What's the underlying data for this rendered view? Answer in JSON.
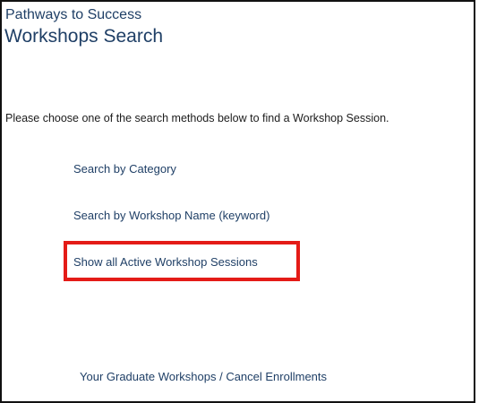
{
  "header": {
    "breadcrumb": "Pathways to Success",
    "title": "Workshops Search"
  },
  "main": {
    "instruction": "Please choose one of the search methods below to find a Workshop Session.",
    "links": [
      {
        "label": "Search by Category"
      },
      {
        "label": "Search by Workshop Name (keyword)"
      },
      {
        "label": "Show all Active Workshop Sessions"
      },
      {
        "label": "Your Graduate Workshops / Cancel Enrollments"
      }
    ]
  },
  "annotation": {
    "highlight_color": "#e41b17"
  }
}
